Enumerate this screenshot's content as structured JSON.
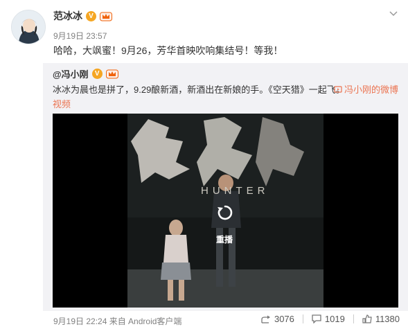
{
  "post": {
    "author": "范冰冰",
    "verified": "V",
    "level_icon": "crown-level-icon",
    "time": "9月19日 23:57",
    "text": "哈哈，大飒蜜！9月26，芳华首映吹响集结号！等我！"
  },
  "repost": {
    "author": "@冯小刚",
    "verified": "V",
    "text": "冰冰为晨也是拼了，9.29酿新酒，新酒出在新娘的手。《空天猎》一起飞。",
    "link_label": "冯小刚的微博",
    "link_label2": "视频",
    "video": {
      "poster_title": "HUNTER",
      "replay_label": "重播"
    },
    "meta": "9月19日 22:24 来自 Android客户端",
    "reposts": "3076",
    "comments": "1019",
    "likes": "11380"
  },
  "colors": {
    "link": "#eb7350",
    "repost_bg": "#f2f2f5",
    "verified": "#f5a623"
  }
}
